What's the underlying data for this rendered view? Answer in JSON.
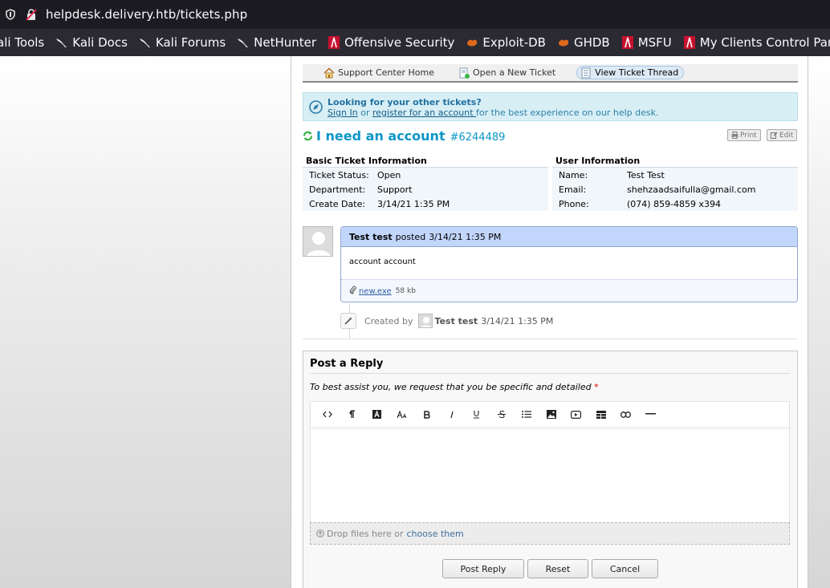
{
  "browser": {
    "url": "helpdesk.delivery.htb/tickets.php",
    "bookmarks": [
      {
        "label": "ali Tools",
        "icon": "kali-dragon-icon"
      },
      {
        "label": "Kali Docs",
        "icon": "kali-dragon-icon"
      },
      {
        "label": "Kali Forums",
        "icon": "kali-dragon-icon"
      },
      {
        "label": "NetHunter",
        "icon": "kali-dragon-icon"
      },
      {
        "label": "Offensive Security",
        "icon": "offsec-icon"
      },
      {
        "label": "Exploit-DB",
        "icon": "exploitdb-icon"
      },
      {
        "label": "GHDB",
        "icon": "exploitdb-icon"
      },
      {
        "label": "MSFU",
        "icon": "offsec-icon"
      },
      {
        "label": "My Clients Control Pan…",
        "icon": "offsec-icon"
      }
    ]
  },
  "nav": {
    "home": "Support Center Home",
    "new_ticket": "Open a New Ticket",
    "view_thread": "View Ticket Thread"
  },
  "notice": {
    "heading": "Looking for your other tickets?",
    "sign_in": "Sign In",
    "or": " or ",
    "register": "register for an account ",
    "tail": "for the best experience on our help desk."
  },
  "ticket": {
    "subject": "I need an account",
    "number": "#6244489",
    "print_label": "Print",
    "edit_label": "Edit"
  },
  "basic_info": {
    "heading": "Basic Ticket Information",
    "rows": [
      {
        "k": "Ticket Status:",
        "v": "Open"
      },
      {
        "k": "Department:",
        "v": "Support"
      },
      {
        "k": "Create Date:",
        "v": "3/14/21 1:35 PM"
      }
    ]
  },
  "user_info": {
    "heading": "User Information",
    "rows": [
      {
        "k": "Name:",
        "v": "Test Test"
      },
      {
        "k": "Email:",
        "v": "shehzaadsaifulla@gmail.com"
      },
      {
        "k": "Phone:",
        "v": "(074) 859-4859 x394"
      }
    ]
  },
  "entry": {
    "author": "Test test",
    "posted_label": "posted",
    "date": "3/14/21 1:35 PM",
    "body": "account account",
    "attachment_name": "new.exe",
    "attachment_size": "58 kb"
  },
  "event": {
    "created_by_label": "Created by",
    "author": "Test test",
    "date": "3/14/21 1:35 PM"
  },
  "reply": {
    "title": "Post a Reply",
    "instructions": "To best assist you, we request that you be specific and detailed",
    "required_mark": "*",
    "toolbar": [
      {
        "label": "<>",
        "icon": "html-code-icon"
      },
      {
        "label": "¶",
        "icon": "paragraph-icon"
      },
      {
        "label": "A",
        "icon": "text-color-icon"
      },
      {
        "label": "Aa",
        "icon": "font-size-icon"
      },
      {
        "label": "B",
        "icon": "bold-icon"
      },
      {
        "label": "I",
        "icon": "italic-icon"
      },
      {
        "label": "U",
        "icon": "underline-icon"
      },
      {
        "label": "S",
        "icon": "strikethrough-icon"
      },
      {
        "label": "list",
        "icon": "unordered-list-icon"
      },
      {
        "label": "image",
        "icon": "image-icon"
      },
      {
        "label": "video",
        "icon": "video-icon"
      },
      {
        "label": "table",
        "icon": "table-icon"
      },
      {
        "label": "link",
        "icon": "link-icon"
      },
      {
        "label": "—",
        "icon": "horizontal-rule-icon"
      }
    ],
    "drop_text": "Drop files here or",
    "choose_text": "choose them",
    "post_label": "Post Reply",
    "reset_label": "Reset",
    "cancel_label": "Cancel"
  }
}
